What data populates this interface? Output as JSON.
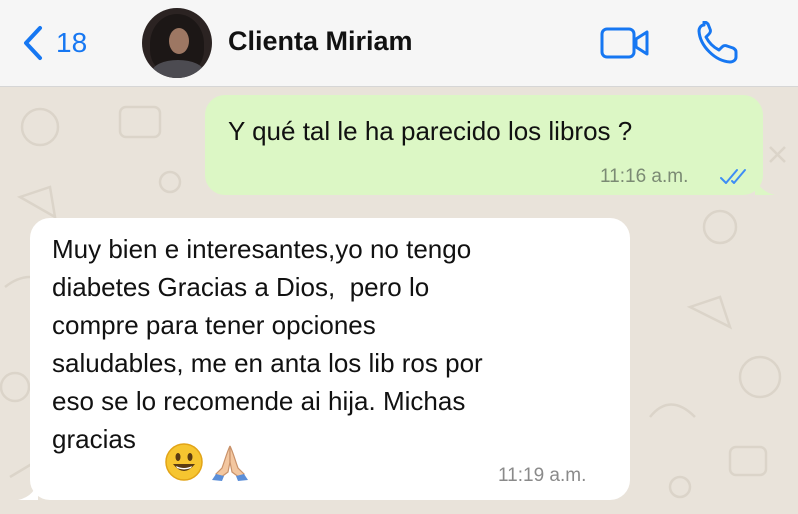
{
  "header": {
    "back_count": "18",
    "contact_name": "Clienta Miriam",
    "icons": {
      "back": "chevron-left-icon",
      "video": "video-camera-icon",
      "call": "phone-icon"
    },
    "accent_color": "#1677f2"
  },
  "messages": [
    {
      "direction": "outgoing",
      "text": "Y qué tal le ha parecido los libros ?",
      "time": "11:16 a.m.",
      "status": "read",
      "bubble_color": "#dcf7c5"
    },
    {
      "direction": "incoming",
      "lines": [
        "Muy bien e interesantes,yo no tengo",
        "diabetes Gracias a Dios,  pero lo",
        "compre para tener opciones",
        "saludables, me en anta los lib ros por",
        "eso se lo recomende ai hija. Michas",
        "gracias"
      ],
      "emojis": [
        "smiling-face-emoji",
        "folded-hands-emoji"
      ],
      "time": "11:19 a.m.",
      "bubble_color": "#ffffff"
    }
  ]
}
